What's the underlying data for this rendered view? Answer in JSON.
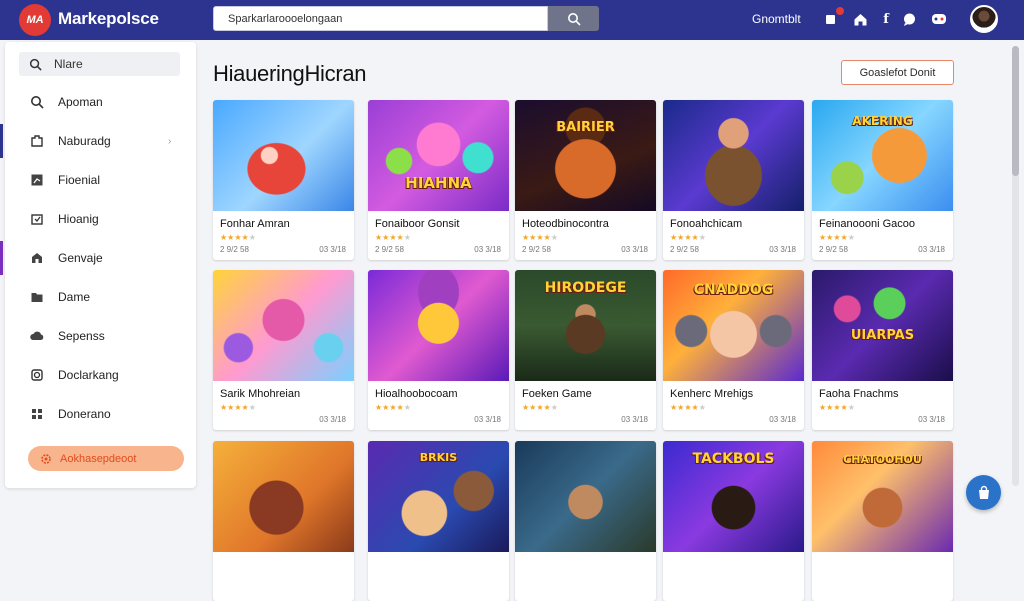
{
  "app": {
    "logo_text": "MA",
    "brand": "Markepolsce"
  },
  "header": {
    "search_value": "Sparkarlaroooelongaan",
    "link": "Gnomtblt"
  },
  "sidebar": {
    "search_placeholder": "Nlare",
    "items": [
      {
        "label": "Apoman",
        "icon": "search-icon"
      },
      {
        "label": "Naburadg",
        "icon": "puzzle-icon"
      },
      {
        "label": "Fioenial",
        "icon": "chart-icon"
      },
      {
        "label": "Hioanig",
        "icon": "box-icon"
      },
      {
        "label": "Genvaje",
        "icon": "house-icon"
      },
      {
        "label": "Dame",
        "icon": "folder-icon"
      },
      {
        "label": "Sepenss",
        "icon": "cloud-icon"
      },
      {
        "label": "Doclarkang",
        "icon": "copy-icon"
      },
      {
        "label": "Donerano",
        "icon": "grid-icon"
      }
    ],
    "cta": "Aokhasepdeoot"
  },
  "main": {
    "title": "HiaueringHicran",
    "action": "Goaslefot Donit"
  },
  "cards": [
    {
      "title": "Fonhar Amran",
      "meta_l": "2 9/2 58",
      "meta_r": "03 3/18",
      "art_label": ""
    },
    {
      "title": "Fonaiboor Gonsit",
      "meta_l": "2 9/2 58",
      "meta_r": "03 3/18",
      "art_label": "HIAHNA"
    },
    {
      "title": "Hoteodbinocontra",
      "meta_l": "2 9/2 58",
      "meta_r": "03 3/18",
      "art_label": "BAIRIER"
    },
    {
      "title": "Fonoahchicam",
      "meta_l": "2 9/2 58",
      "meta_r": "03 3/18",
      "art_label": ""
    },
    {
      "title": "Feinanoooni Gacoo",
      "meta_l": "2 9/2 58",
      "meta_r": "03 3/18",
      "art_label": "AKERING"
    },
    {
      "title": "Sarik Mhohreian",
      "meta_l": "",
      "meta_r": "03 3/18",
      "art_label": ""
    },
    {
      "title": "Hioalhoobocoam",
      "meta_l": "",
      "meta_r": "03 3/18",
      "art_label": ""
    },
    {
      "title": "Foeken Game",
      "meta_l": "",
      "meta_r": "03 3/18",
      "art_label": "HIRODEGE"
    },
    {
      "title": "Kenherc Mrehigs",
      "meta_l": "",
      "meta_r": "03 3/18",
      "art_label": "CNADDOG"
    },
    {
      "title": "Faoha Fnachms",
      "meta_l": "",
      "meta_r": "03 3/18",
      "art_label": "UIARPAS"
    },
    {
      "title": "",
      "meta_l": "",
      "meta_r": "",
      "art_label": ""
    },
    {
      "title": "",
      "meta_l": "",
      "meta_r": "",
      "art_label": "BRKIS"
    },
    {
      "title": "",
      "meta_l": "",
      "meta_r": "",
      "art_label": ""
    },
    {
      "title": "",
      "meta_l": "",
      "meta_r": "",
      "art_label": "TACKBOLS"
    },
    {
      "title": "",
      "meta_l": "",
      "meta_r": "",
      "art_label": "CHATOOHOU"
    }
  ],
  "colors": {
    "header": "#2c3490",
    "accent": "#e23a35",
    "star": "#f5a623",
    "fab": "#2a73c9"
  }
}
